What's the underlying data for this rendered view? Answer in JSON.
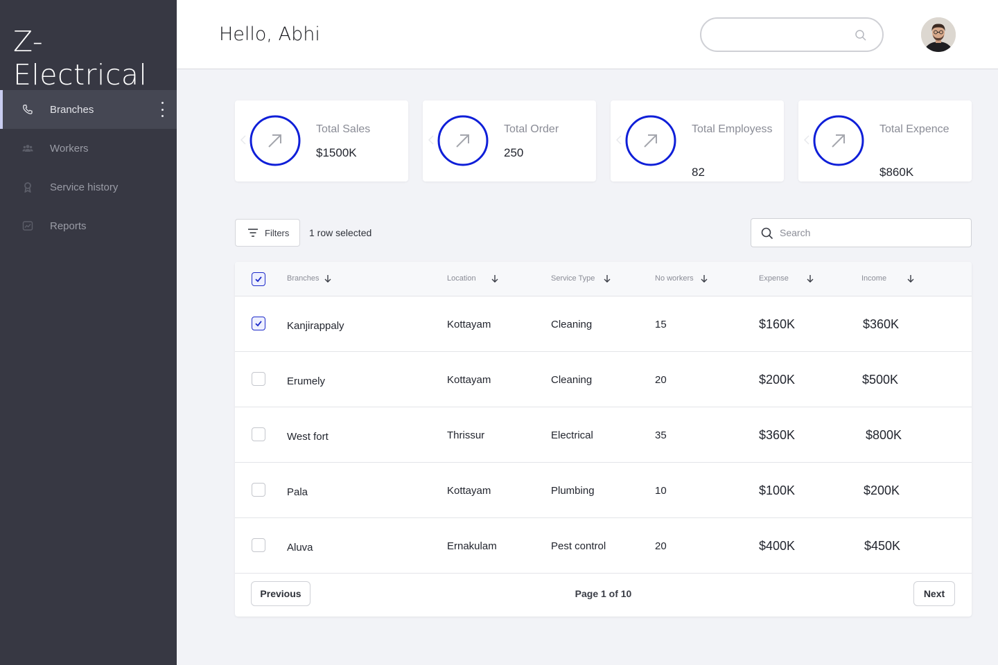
{
  "app": {
    "title": "Z-Electrical"
  },
  "sidebar": {
    "items": [
      {
        "label": "Branches",
        "icon": "phone-icon"
      },
      {
        "label": "Workers",
        "icon": "users-icon"
      },
      {
        "label": "Service history",
        "icon": "award-icon"
      },
      {
        "label": "Reports",
        "icon": "chart-icon"
      }
    ],
    "active_item": "Branches"
  },
  "header": {
    "greeting": "Hello, Abhi",
    "search_placeholder": ""
  },
  "stats": [
    {
      "label": "Total Sales",
      "value": "$1500K"
    },
    {
      "label": "Total Order",
      "value": "250"
    },
    {
      "label": "Total Employess",
      "value": "82"
    },
    {
      "label": "Total Expence",
      "value": "$860K"
    }
  ],
  "toolbar": {
    "filters_label": "Filters",
    "selection_text": "1 row selected",
    "search_placeholder": "Search"
  },
  "table": {
    "columns": [
      "Branches",
      "Location",
      "Service Type",
      "No workers",
      "Expense",
      "Income"
    ],
    "rows": [
      {
        "branch": "Kanjirappaly",
        "location": "Kottayam",
        "service": "Cleaning",
        "workers": "15",
        "expense": "$160K",
        "income": "$360K",
        "selected": true
      },
      {
        "branch": "Erumely",
        "location": "Kottayam",
        "service": "Cleaning",
        "workers": "20",
        "expense": "$200K",
        "income": "$500K",
        "selected": false
      },
      {
        "branch": "West fort",
        "location": "Thrissur",
        "service": "Electrical",
        "workers": "35",
        "expense": "$360K",
        "income": "$800K",
        "selected": false
      },
      {
        "branch": "Pala",
        "location": "Kottayam",
        "service": "Plumbing",
        "workers": "10",
        "expense": "$100K",
        "income": "$200K",
        "selected": false
      },
      {
        "branch": "Aluva",
        "location": "Ernakulam",
        "service": "Pest control",
        "workers": "20",
        "expense": "$400K",
        "income": "$450K",
        "selected": false
      }
    ]
  },
  "pagination": {
    "previous_label": "Previous",
    "next_label": "Next",
    "page_text": "Page 1 of 10"
  },
  "colors": {
    "sidebar_bg": "#373843",
    "accent": "#1d2ac9",
    "page_bg": "#f2f3f7"
  }
}
